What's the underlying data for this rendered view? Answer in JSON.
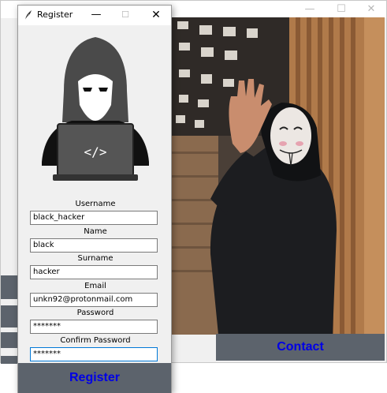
{
  "background_window": {
    "contact_label": "Contact",
    "controls": {
      "minimize": "—",
      "maximize": "☐",
      "close": "✕"
    }
  },
  "register_window": {
    "title": "Register",
    "controls": {
      "minimize": "—",
      "maximize": "☐",
      "close": "✕"
    },
    "avatar_code": "</>",
    "fields": [
      {
        "label": "Username",
        "value": "black_hacker"
      },
      {
        "label": "Name",
        "value": "black"
      },
      {
        "label": "Surname",
        "value": "hacker"
      },
      {
        "label": "Email",
        "value": "unkn92@protonmail.com"
      },
      {
        "label": "Password",
        "value": "*******"
      },
      {
        "label": "Confirm Password",
        "value": "*******"
      }
    ],
    "register_label": "Register"
  },
  "colors": {
    "button_bg": "#5c636c",
    "button_text": "#0000e6",
    "focus_border": "#0078d7"
  }
}
